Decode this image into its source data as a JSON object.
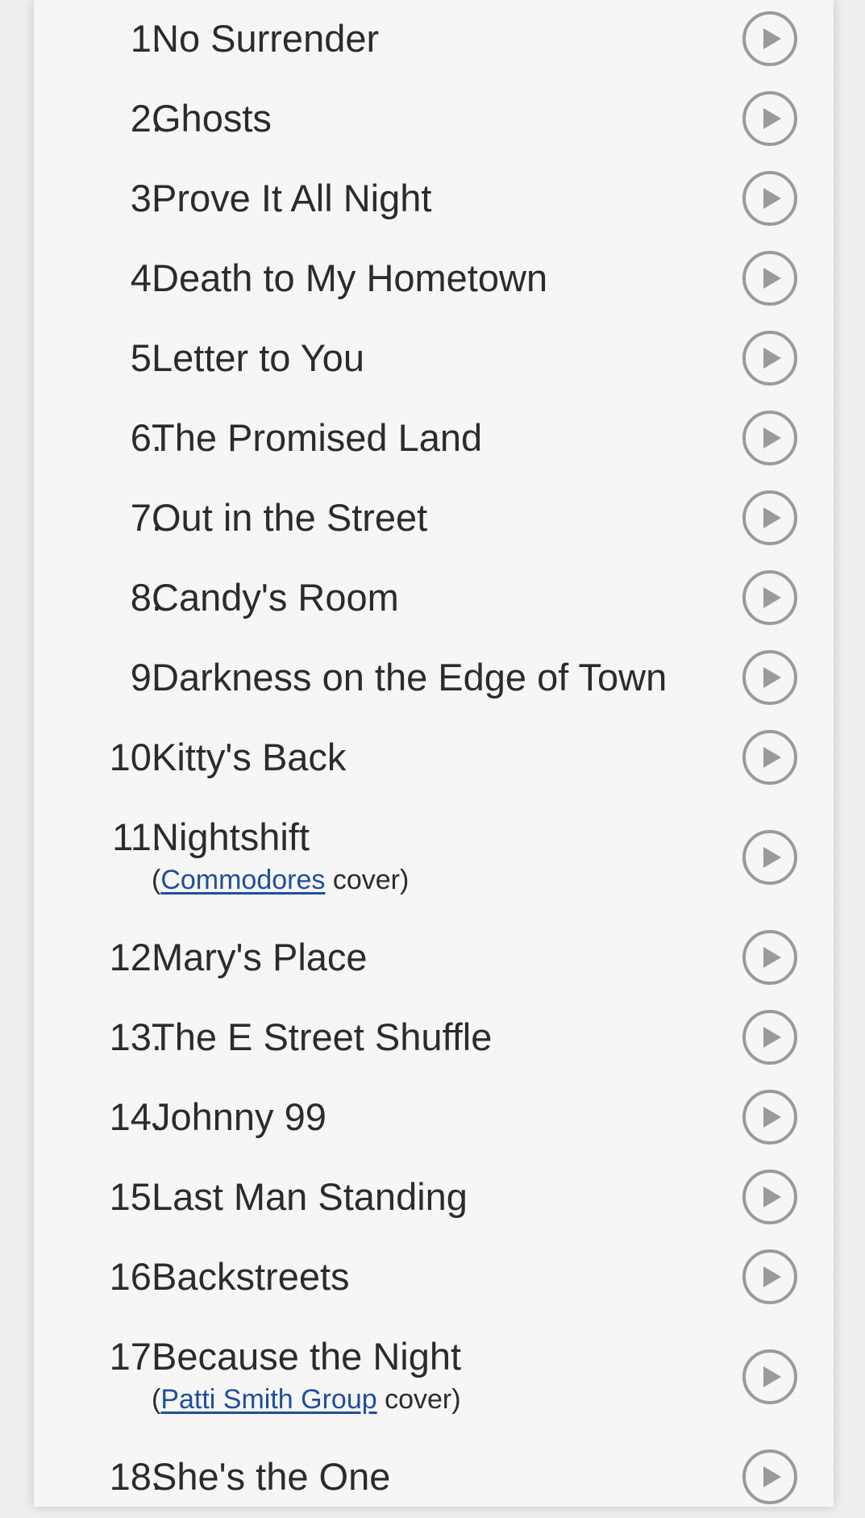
{
  "setlist": {
    "colors": {
      "page_background": "#f6f6f6",
      "text": "#2b2b2b",
      "link": "#1f4f9a",
      "play_icon": "#9a9a9a"
    },
    "songs": [
      {
        "number": "1.",
        "title": "No Surrender",
        "icon": "play-icon"
      },
      {
        "number": "2.",
        "title": "Ghosts",
        "icon": "play-icon"
      },
      {
        "number": "3.",
        "title": "Prove It All Night",
        "icon": "play-icon"
      },
      {
        "number": "4.",
        "title": "Death to My Hometown",
        "icon": "play-icon"
      },
      {
        "number": "5.",
        "title": "Letter to You",
        "icon": "play-icon"
      },
      {
        "number": "6.",
        "title": "The Promised Land",
        "icon": "play-icon"
      },
      {
        "number": "7.",
        "title": "Out in the Street",
        "icon": "play-icon"
      },
      {
        "number": "8.",
        "title": "Candy's Room",
        "icon": "play-icon"
      },
      {
        "number": "9.",
        "title": "Darkness on the Edge of Town",
        "icon": "play-icon"
      },
      {
        "number": "10.",
        "title": "Kitty's Back",
        "icon": "play-icon"
      },
      {
        "number": "11.",
        "title": "Nightshift",
        "note": {
          "prefix": "(",
          "artist": "Commodores",
          "suffix": " cover)"
        },
        "icon": "play-icon"
      },
      {
        "number": "12.",
        "title": "Mary's Place",
        "icon": "play-icon"
      },
      {
        "number": "13.",
        "title": "The E Street Shuffle",
        "icon": "play-icon"
      },
      {
        "number": "14.",
        "title": "Johnny 99",
        "icon": "play-icon"
      },
      {
        "number": "15.",
        "title": "Last Man Standing",
        "icon": "play-icon"
      },
      {
        "number": "16.",
        "title": "Backstreets",
        "icon": "play-icon"
      },
      {
        "number": "17.",
        "title": "Because the Night",
        "note": {
          "prefix": "(",
          "artist": "Patti Smith Group",
          "suffix": " cover)"
        },
        "icon": "play-icon"
      },
      {
        "number": "18.",
        "title": "She's the One",
        "icon": "play-icon"
      }
    ]
  }
}
